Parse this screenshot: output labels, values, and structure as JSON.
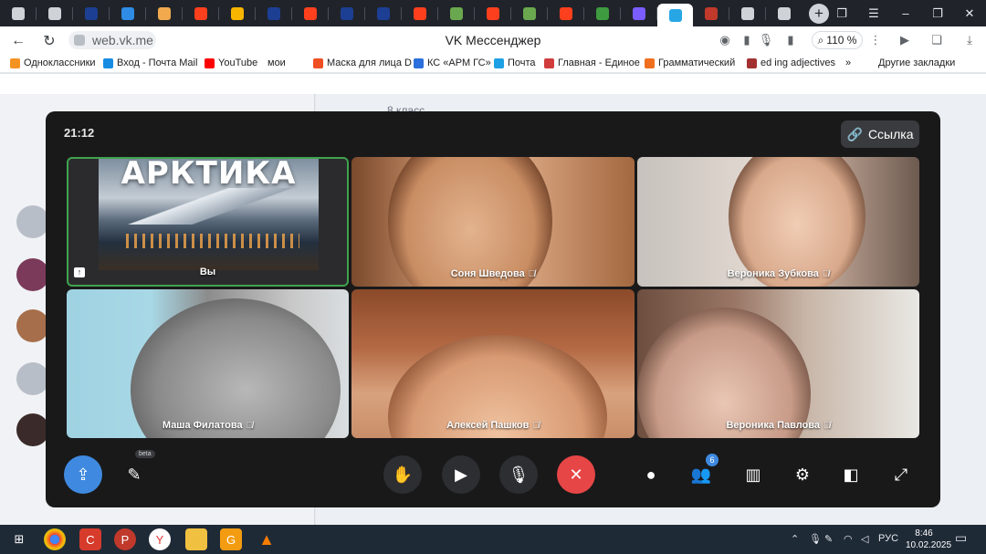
{
  "browser": {
    "tabs": [
      {
        "icon": "speaker-icon",
        "color": "#cfd3d8"
      },
      {
        "icon": "chevron-down-icon",
        "color": "#cfd3d8"
      },
      {
        "icon": "uk-flag-icon",
        "color": "#1c3f94"
      },
      {
        "icon": "safari-icon",
        "color": "#2e8ce6"
      },
      {
        "icon": "document-icon",
        "color": "#f1a94e"
      },
      {
        "icon": "yandex-icon",
        "color": "#fc3f1d"
      },
      {
        "icon": "play-icon",
        "color": "#f7b500"
      },
      {
        "icon": "uk-flag-icon",
        "color": "#1c3f94"
      },
      {
        "icon": "yandex-icon",
        "color": "#fc3f1d"
      },
      {
        "icon": "uk-flag-icon",
        "color": "#1c3f94"
      },
      {
        "icon": "uk-flag-icon",
        "color": "#1c3f94"
      },
      {
        "icon": "yandex-icon",
        "color": "#fc3f1d"
      },
      {
        "icon": "android-icon",
        "color": "#6aa84f"
      },
      {
        "icon": "yandex-icon",
        "color": "#fc3f1d"
      },
      {
        "icon": "android-icon",
        "color": "#6aa84f"
      },
      {
        "icon": "yandex-icon",
        "color": "#fc3f1d"
      },
      {
        "icon": "hd-icon",
        "color": "#3f9b3f"
      },
      {
        "icon": "gradient-circle-icon",
        "color": "#7b5cff"
      },
      {
        "icon": "vk-call-icon",
        "color": "#27a6e5",
        "active": true
      },
      {
        "icon": "red-dot-icon",
        "color": "#c0392b"
      },
      {
        "icon": "speaker-icon",
        "color": "#cfd3d8"
      },
      {
        "icon": "document-icon",
        "color": "#cfd3d8"
      }
    ],
    "new_tab_label": "+",
    "url": "web.vk.me",
    "page_title": "VK Мессенджер",
    "zoom": "110 %",
    "bookmarks": [
      {
        "label": "Одноклассники",
        "color": "#f59322"
      },
      {
        "label": "Вход - Почта Mail",
        "color": "#168de2"
      },
      {
        "label": "YouTube",
        "color": "#ff0000"
      },
      {
        "label": "мои",
        "color": "#ffffff"
      },
      {
        "label": "Маска для лица D",
        "color": "#f04e23"
      },
      {
        "label": "КС «АРМ ГС»",
        "color": "#2a6fdb"
      },
      {
        "label": "Почта",
        "color": "#1ea1e4"
      },
      {
        "label": "Главная - Единое",
        "color": "#d13c3c"
      },
      {
        "label": "Грамматический",
        "color": "#f06f1e"
      },
      {
        "label": "ed ing adjectives",
        "color": "#a33030"
      },
      {
        "label": "»",
        "color": "#ffffff"
      },
      {
        "label": "Другие закладки",
        "color": "#ffffff"
      }
    ]
  },
  "background": {
    "chat_title": "8 класс"
  },
  "call": {
    "time": "21:12",
    "link_label": "Ссылка",
    "participants": [
      {
        "name": "Вы",
        "muted": false
      },
      {
        "name": "Соня Шведова",
        "muted": true
      },
      {
        "name": "Вероника Зубкова",
        "muted": true
      },
      {
        "name": "Маша Филатова",
        "muted": true
      },
      {
        "name": "Алексей Пашков",
        "muted": true
      },
      {
        "name": "Вероника Павлова",
        "muted": true
      }
    ],
    "shared_screen_text": "АРКТИКА",
    "beta_label": "beta",
    "participants_count": "6",
    "mic_off_glyph": "🎙"
  },
  "taskbar": {
    "language": "РУС",
    "time": "8:46",
    "date": "10.02.2025"
  }
}
